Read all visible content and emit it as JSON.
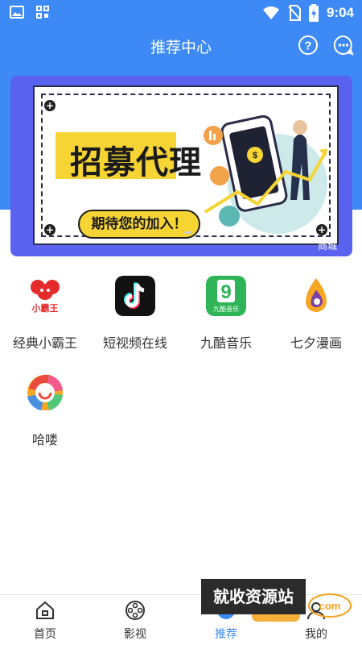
{
  "status_bar": {
    "time": "9:04",
    "left_icons": [
      "image-icon",
      "grid-icon"
    ],
    "right_icons": [
      "wifi-icon",
      "no-sim-icon",
      "battery-charging-icon"
    ]
  },
  "header": {
    "title": "推荐中心",
    "icons": [
      "help-icon",
      "chat-icon"
    ]
  },
  "banner": {
    "headline": "招募代理",
    "pill_text": "期待您的加入！",
    "corner_text": "商城"
  },
  "apps": [
    {
      "label": "经典小霸王",
      "icon": "xiaobawang-icon",
      "icon_text": "小霸王"
    },
    {
      "label": "短视频在线",
      "icon": "tiktok-icon"
    },
    {
      "label": "九酷音乐",
      "icon": "jiuku-music-icon",
      "icon_text": "九酷音乐"
    },
    {
      "label": "七夕漫画",
      "icon": "qixi-comic-icon"
    },
    {
      "label": "哈喽",
      "icon": "halou-icon"
    }
  ],
  "bottom_nav": [
    {
      "label": "首页",
      "icon": "home-icon",
      "active": false
    },
    {
      "label": "影视",
      "icon": "film-reel-icon",
      "active": false
    },
    {
      "label": "推荐",
      "icon": "recommend-icon",
      "active": true
    },
    {
      "label": "我的",
      "icon": "profile-icon",
      "active": false
    }
  ],
  "watermark": {
    "text": "就收资源站",
    "logo_text": "com"
  },
  "colors": {
    "primary": "#3d8af7",
    "banner_bg": "#5a63f0",
    "accent_yellow": "#f6d434"
  }
}
